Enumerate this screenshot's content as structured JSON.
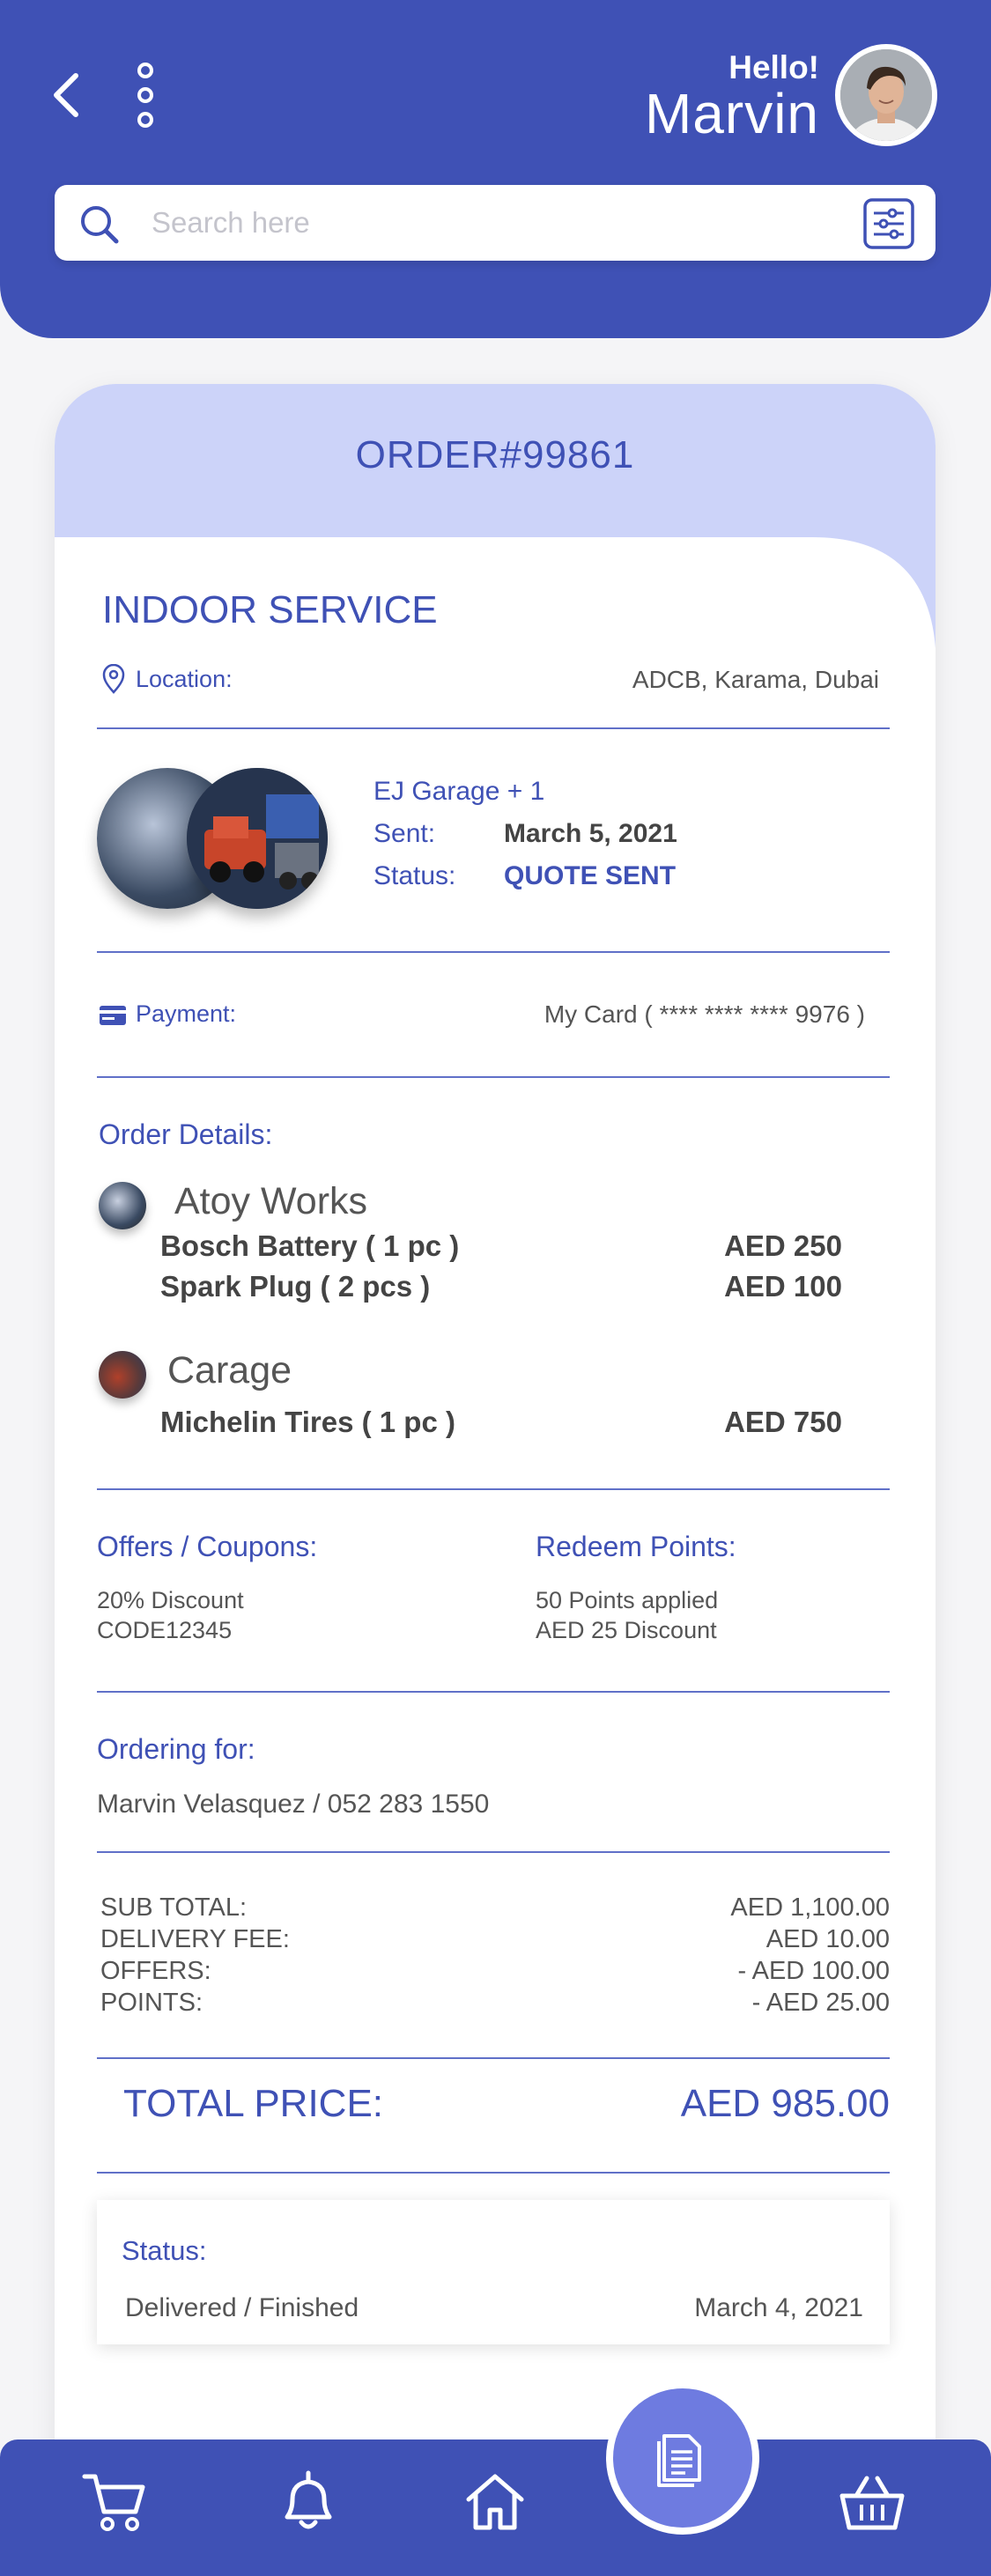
{
  "header": {
    "greeting": "Hello!",
    "username": "Marvin"
  },
  "search": {
    "placeholder": "Search here",
    "value": ""
  },
  "order": {
    "number": "ORDER#99861",
    "service_type": "INDOOR SERVICE",
    "location_label": "Location:",
    "location_value": "ADCB, Karama, Dubai",
    "garage": "EJ Garage + 1",
    "sent_label": "Sent:",
    "sent_value": "March 5, 2021",
    "status_label": "Status:",
    "status_value": "QUOTE SENT",
    "payment_label": "Payment:",
    "payment_value": "My Card ( **** **** **** 9976 )"
  },
  "order_details": {
    "title": "Order Details:",
    "shops": [
      {
        "name": "Atoy Works",
        "items": [
          {
            "name": "Bosch Battery  ( 1 pc )",
            "price": "AED 250"
          },
          {
            "name": "Spark Plug  ( 2 pcs )",
            "price": "AED 100"
          }
        ]
      },
      {
        "name": "Carage",
        "items": [
          {
            "name": "Michelin Tires  ( 1 pc )",
            "price": "AED 750"
          }
        ]
      }
    ]
  },
  "offers": {
    "title": "Offers / Coupons:",
    "line1": "20% Discount",
    "line2": "CODE12345"
  },
  "redeem": {
    "title": "Redeem Points:",
    "line1": "50 Points applied",
    "line2": "AED 25 Discount"
  },
  "ordering_for": {
    "title": "Ordering for:",
    "value": "Marvin Velasquez / 052 283 1550"
  },
  "summary": [
    {
      "label": "SUB TOTAL:",
      "value": "AED 1,100.00"
    },
    {
      "label": "DELIVERY FEE:",
      "value": "AED 10.00"
    },
    {
      "label": "OFFERS:",
      "value": "- AED 100.00"
    },
    {
      "label": "POINTS:",
      "value": "- AED 25.00"
    }
  ],
  "total": {
    "label": "TOTAL PRICE:",
    "value": "AED 985.00"
  },
  "status_box": {
    "title": "Status:",
    "value": "Delivered / Finished",
    "date": "March 4, 2021"
  },
  "nav": {
    "icons": [
      "cart-icon",
      "bell-icon",
      "home-icon",
      "orders-icon",
      "basket-icon"
    ]
  },
  "colors": {
    "primary": "#3f51b5",
    "accent_light": "#ccd3f9",
    "fab": "#6e7be0"
  }
}
